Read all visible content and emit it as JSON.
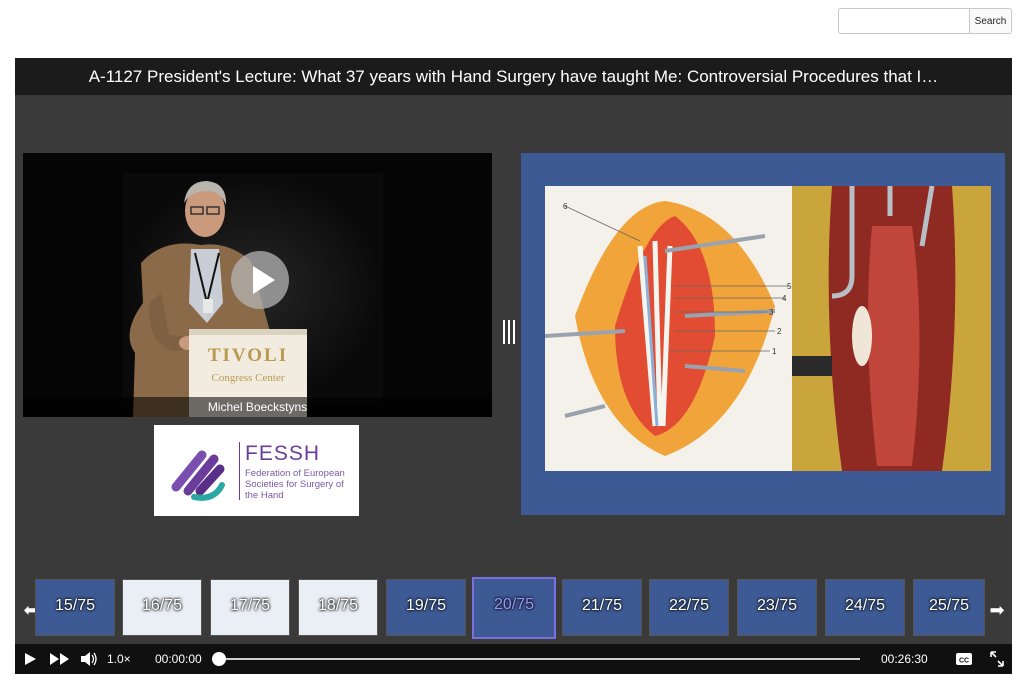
{
  "search": {
    "placeholder": "",
    "button_label": "Search"
  },
  "lecture": {
    "title": "A-1127 President's Lecture: What 37 years with Hand Surgery have taught Me: Controversial Procedures that I…",
    "speaker": "Michel Boeckstyns"
  },
  "podium": {
    "line1": "TIVOLI",
    "line2": "Congress Center"
  },
  "logo": {
    "name": "FESSH",
    "subtitle": "Federation of European Societies for Surgery of the Hand"
  },
  "thumbnails": [
    {
      "label": "15/75"
    },
    {
      "label": "16/75"
    },
    {
      "label": "17/75"
    },
    {
      "label": "18/75"
    },
    {
      "label": "19/75"
    },
    {
      "label": "20/75"
    },
    {
      "label": "21/75"
    },
    {
      "label": "22/75"
    },
    {
      "label": "23/75"
    },
    {
      "label": "24/75"
    },
    {
      "label": "25/75"
    }
  ],
  "controls": {
    "speed": "1.0×",
    "current_time": "00:00:00",
    "duration": "00:26:30",
    "progress": 0,
    "cc_label": "CC"
  },
  "slide": {
    "labels": [
      "6",
      "5",
      "4",
      "3",
      "2",
      "1"
    ]
  },
  "colors": {
    "slide_bg": "#3d5a94",
    "accent": "#7b6fe0",
    "brand": "#6a3d9a"
  }
}
